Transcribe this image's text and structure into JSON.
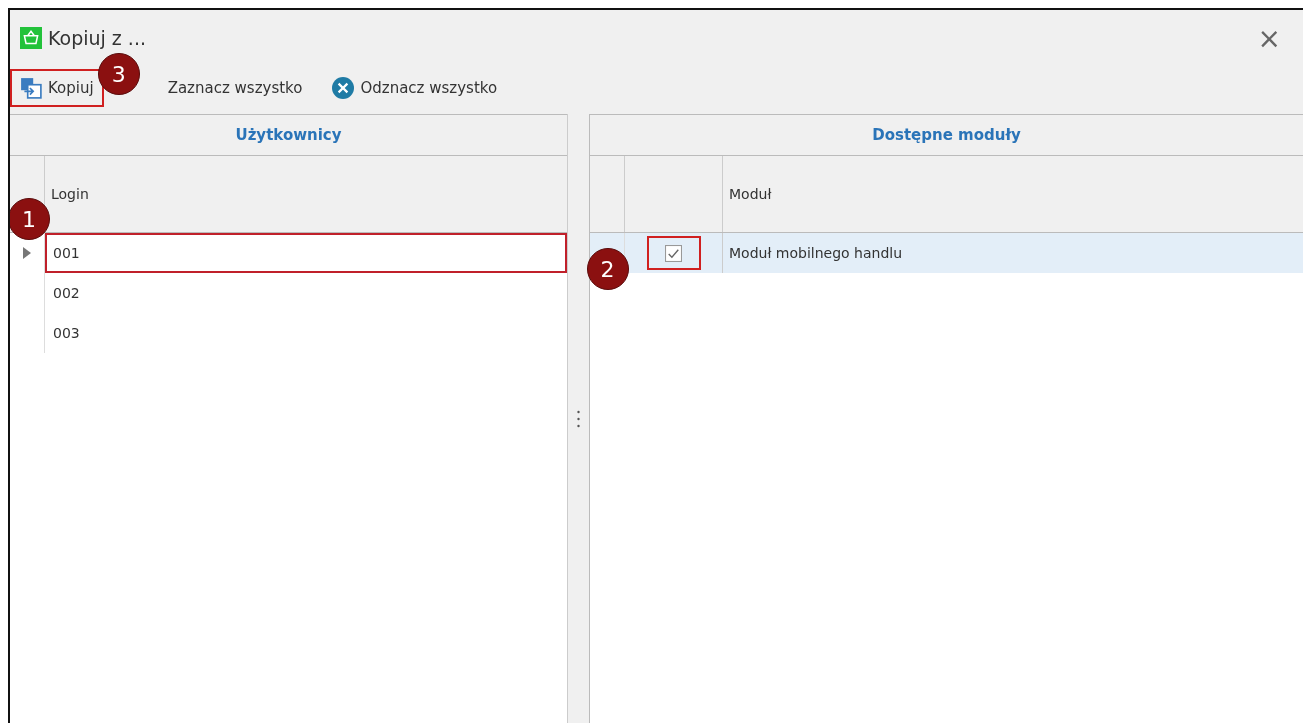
{
  "window": {
    "title": "Kopiuj z ...",
    "close": "×"
  },
  "toolbar": [
    {
      "kind": "copy",
      "label": "Kopiuj",
      "highlighted": true,
      "callout": "3"
    },
    {
      "kind": "check",
      "label": "Zaznacz wszystko",
      "highlighted": false
    },
    {
      "kind": "uncheck",
      "label": "Odznacz wszystko",
      "highlighted": false
    }
  ],
  "users": {
    "title": "Użytkownicy",
    "column": "Login",
    "callout": "1",
    "rows": [
      {
        "login": "001",
        "selected": true,
        "highlighted": true
      },
      {
        "login": "002",
        "selected": false,
        "highlighted": false
      },
      {
        "login": "003",
        "selected": false,
        "highlighted": false
      }
    ]
  },
  "modules": {
    "title": "Dostępne moduły",
    "column": "Moduł",
    "rows": [
      {
        "name": "Moduł mobilnego handlu",
        "checked": true,
        "selected": true,
        "highlighted": true,
        "callout": "2"
      }
    ]
  }
}
